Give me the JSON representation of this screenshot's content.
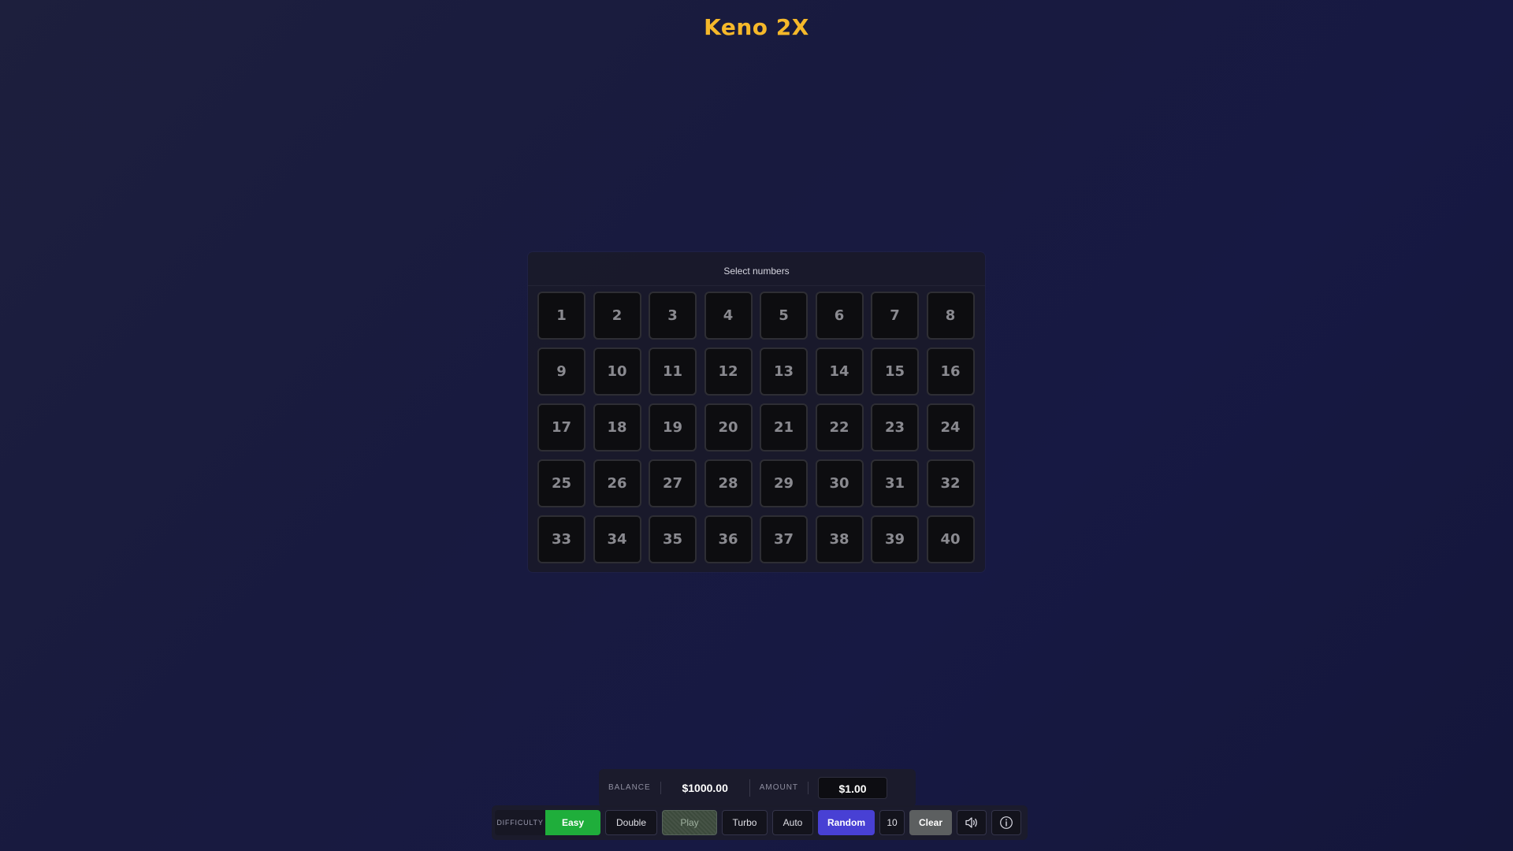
{
  "game": {
    "title": "Keno 2X"
  },
  "board": {
    "header": "Select numbers",
    "numbers": [
      "1",
      "2",
      "3",
      "4",
      "5",
      "6",
      "7",
      "8",
      "9",
      "10",
      "11",
      "12",
      "13",
      "14",
      "15",
      "16",
      "17",
      "18",
      "19",
      "20",
      "21",
      "22",
      "23",
      "24",
      "25",
      "26",
      "27",
      "28",
      "29",
      "30",
      "31",
      "32",
      "33",
      "34",
      "35",
      "36",
      "37",
      "38",
      "39",
      "40"
    ]
  },
  "wallet": {
    "balance_label": "BALANCE",
    "balance_value": "$1000.00",
    "amount_label": "AMOUNT",
    "amount_value": "$1.00"
  },
  "controls": {
    "difficulty_label": "DIFFICULTY",
    "difficulty_value": "Easy",
    "double_label": "Double",
    "play_label": "Play",
    "turbo_label": "Turbo",
    "auto_label": "Auto",
    "random_label": "Random",
    "random_count": "10",
    "clear_label": "Clear",
    "sound_icon": "speaker-icon",
    "info_icon": "info-icon"
  },
  "colors": {
    "title": "#f5b82a",
    "easy": "#1fae3b",
    "random": "#4840d4",
    "clear": "#5c5f60"
  }
}
